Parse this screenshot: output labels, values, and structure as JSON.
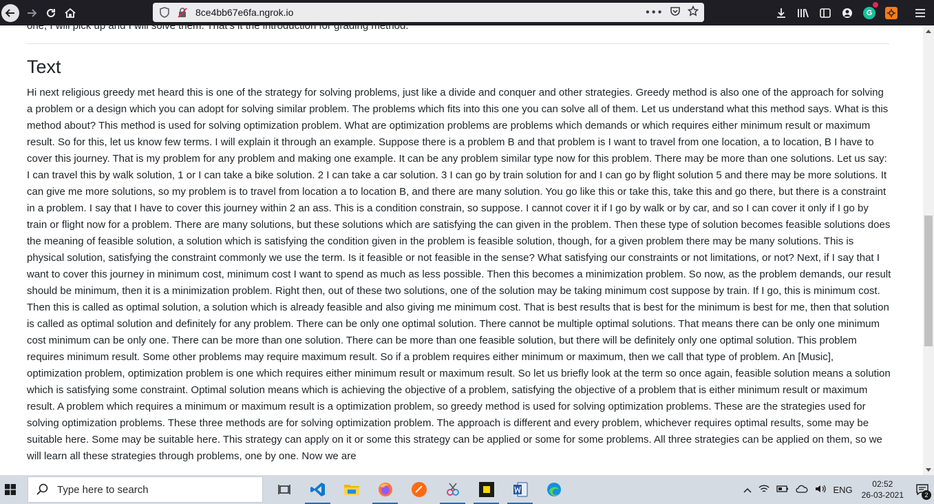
{
  "browser": {
    "url": "8ce4bb67e6fa.ngrok.io",
    "page_actions_label": "•••"
  },
  "page": {
    "previous_line": "one, I will pick up and I will solve them. That's it the introduction for grading method.",
    "section_title": "Text",
    "body": "Hi next religious greedy met heard this is one of the strategy for solving problems, just like a divide and conquer and other strategies. Greedy method is also one of the approach for solving a problem or a design which you can adopt for solving similar problem. The problems which fits into this one you can solve all of them. Let us understand what this method says. What is this method about? This method is used for solving optimization problem. What are optimization problems are problems which demands or which requires either minimum result or maximum result. So for this, let us know few terms. I will explain it through an example. Suppose there is a problem B and that problem is I want to travel from one location, a to location, B I have to cover this journey. That is my problem for any problem and making one example. It can be any problem similar type now for this problem. There may be more than one solutions. Let us say: I can travel this by walk solution, 1 or I can take a bike solution. 2 I can take a car solution. 3 I can go by train solution for and I can go by flight solution 5 and there may be more solutions. It can give me more solutions, so my problem is to travel from location a to location B, and there are many solution. You go like this or take this, take this and go there, but there is a constraint in a problem. I say that I have to cover this journey within 2 an ass. This is a condition constrain, so suppose. I cannot cover it if I go by walk or by car, and so I can cover it only if I go by train or flight now for a problem. There are many solutions, but these solutions which are satisfying the can given in the problem. Then these type of solution becomes feasible solutions does the meaning of feasible solution, a solution which is satisfying the condition given in the problem is feasible solution, though, for a given problem there may be many solutions. This is physical solution, satisfying the constraint commonly we use the term. Is it feasible or not feasible in the sense? What satisfying our constraints or not limitations, or not? Next, if I say that I want to cover this journey in minimum cost, minimum cost I want to spend as much as less possible. Then this becomes a minimization problem. So now, as the problem demands, our result should be minimum, then it is a minimization problem. Right then, out of these two solutions, one of the solution may be taking minimum cost suppose by train. If I go, this is minimum cost. Then this is called as optimal solution, a solution which is already feasible and also giving me minimum cost. That is best results that is best for the minimum is best for me, then that solution is called as optimal solution and definitely for any problem. There can be only one optimal solution. There cannot be multiple optimal solutions. That means there can be only one minimum cost minimum can be only one. There can be more than one solution. There can be more than one feasible solution, but there will be definitely only one optimal solution. This problem requires minimum result. Some other problems may require maximum result. So if a problem requires either minimum or maximum, then we call that type of problem. An [Music], optimization problem, optimization problem is one which requires either minimum result or maximum result. So let us briefly look at the term so once again, feasible solution means a solution which is satisfying some constraint. Optimal solution means which is achieving the objective of a problem, satisfying the objective of a problem that is either minimum result or maximum result. A problem which requires a minimum or maximum result is a optimization problem, so greedy method is used for solving optimization problems. These are the strategies used for solving optimization problems. These three methods are for solving optimization problem. The approach is different and every problem, whichever requires optimal results, some may be suitable here. Some may be suitable here. This strategy can apply on it or some this strategy can be applied or some for some problems. All three strategies can be applied on them, so we will learn all these strategies through problems, one by one. Now we are"
  },
  "taskbar": {
    "search_placeholder": "Type here to search",
    "language": "ENG",
    "time": "02:52",
    "date": "26-03-2021",
    "notification_count": "2"
  }
}
